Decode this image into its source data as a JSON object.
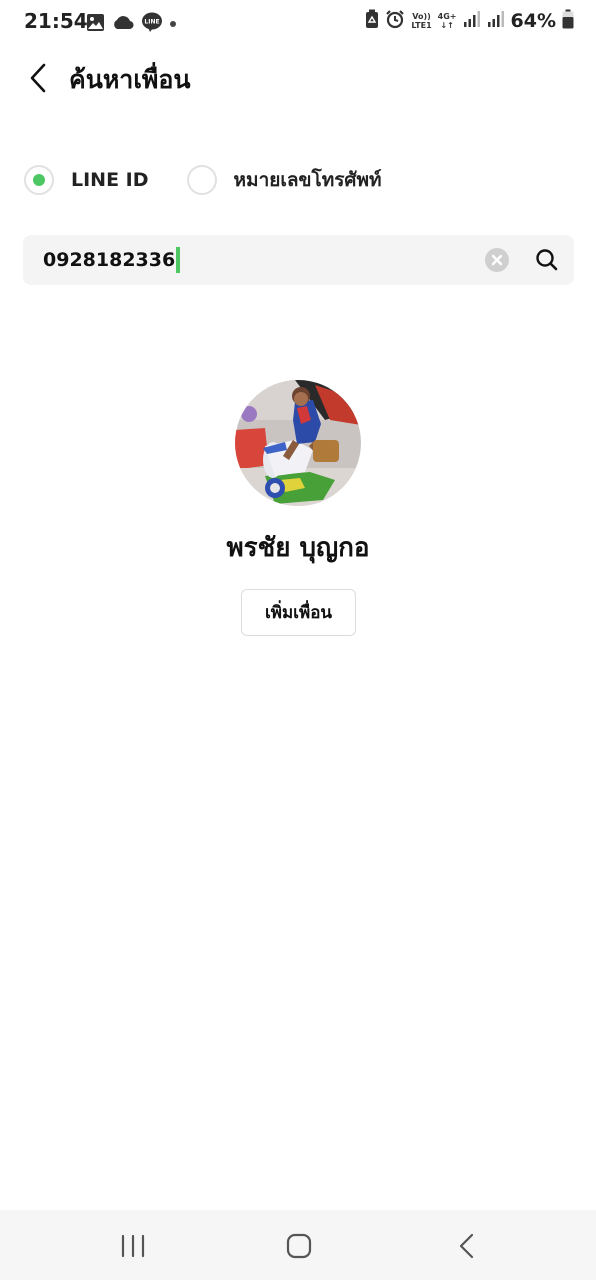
{
  "status_bar": {
    "time": "21:54",
    "left_icons": [
      "image-icon",
      "cloud-icon",
      "line-app-icon",
      "dot-icon"
    ],
    "volte_top": "Vo))",
    "volte_bottom": "LTE1",
    "network_type": "4G+",
    "battery_percent": "64%",
    "line_icon_text": "LINE"
  },
  "header": {
    "title": "ค้นหาเพื่อน"
  },
  "search_type": {
    "options": [
      {
        "label": "LINE ID",
        "selected": true
      },
      {
        "label": "หมายเลขโทรศัพท์",
        "selected": false
      }
    ]
  },
  "search": {
    "value": "0928182336"
  },
  "profile": {
    "name": "พรชัย บุญกอ",
    "add_button_label": "เพิ่มเพื่อน"
  },
  "colors": {
    "accent": "#4cc764",
    "search_bg": "#f4f4f4",
    "nav_bg": "#f6f6f6"
  }
}
